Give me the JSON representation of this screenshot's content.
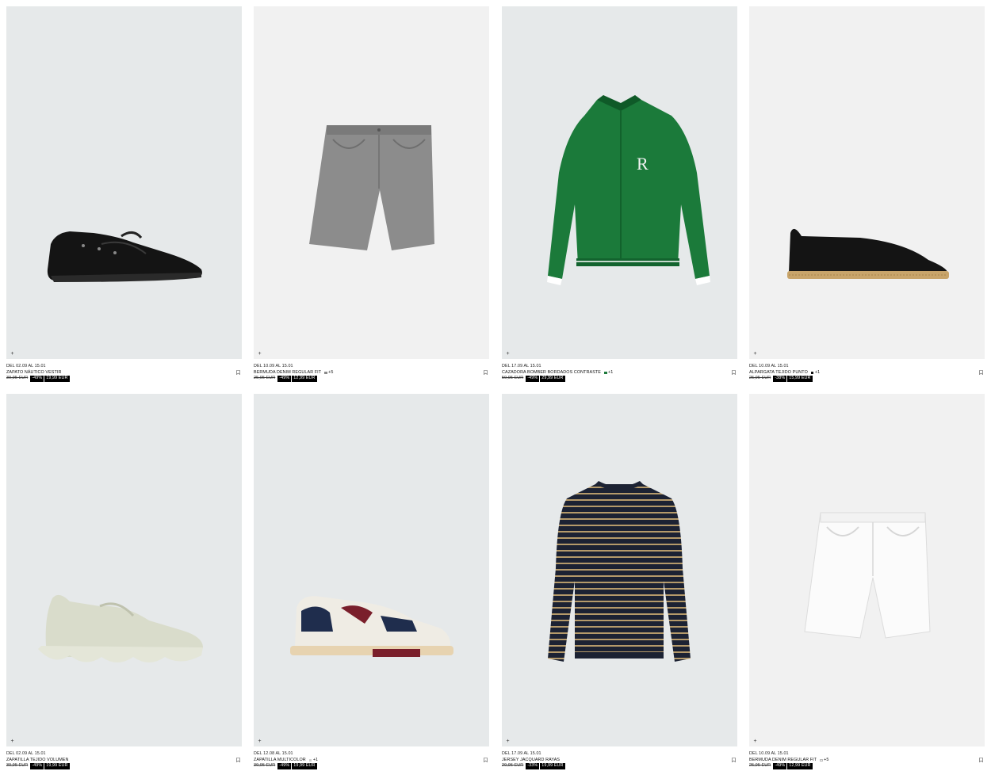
{
  "products": [
    {
      "date": "DEL 02.09 AL 15.01",
      "name": "ZAPATO NÁUTICO VESTIR",
      "swatch": "",
      "more": "",
      "old_price": "39,95 EUR",
      "discount": "-49%",
      "new_price": "19,99 EUR",
      "bg": "#e6e9ea",
      "icon": "boat-shoe"
    },
    {
      "date": "DEL 10.09 AL 15.01",
      "name": "BERMUDA DENIM REGULAR FIT",
      "swatch": "#8a8a8a",
      "more": "+5",
      "old_price": "25,95 EUR",
      "discount": "-49%",
      "new_price": "12,99 EUR",
      "bg": "#f1f1f1",
      "icon": "denim-shorts"
    },
    {
      "date": "DEL 17.09 AL 15.01",
      "name": "CAZADORA BOMBER BORDADOS CONTRASTE",
      "swatch": "#1f7a3d",
      "more": "+1",
      "old_price": "59,95 EUR",
      "discount": "-49%",
      "new_price": "29,99 EUR",
      "bg": "#e6e9ea",
      "icon": "bomber-jacket"
    },
    {
      "date": "DEL 10.09 AL 15.01",
      "name": "ALPARGATA TEJIDO PUNTO",
      "swatch": "#111111",
      "more": "+1",
      "old_price": "25,95 EUR",
      "discount": "-38%",
      "new_price": "15,99 EUR",
      "bg": "#f1f1f1",
      "icon": "espadrille"
    },
    {
      "date": "DEL 02.09 AL 15.01",
      "name": "ZAPATILLA TEJIDO VOLUMEN",
      "swatch": "",
      "more": "",
      "old_price": "39,95 EUR",
      "discount": "-49%",
      "new_price": "19,99 EUR",
      "bg": "#e6e9ea",
      "icon": "knit-sneaker"
    },
    {
      "date": "DEL 12.08 AL 15.01",
      "name": "ZAPATILLA MULTICOLOR",
      "swatch": "#cfcfcf",
      "more": "+1",
      "old_price": "39,95 EUR",
      "discount": "-49%",
      "new_price": "19,99 EUR",
      "bg": "#e6e9ea",
      "icon": "multicolor-sneaker"
    },
    {
      "date": "DEL 17.09 AL 15.01",
      "name": "JERSEY JACQUARD RAYAS",
      "swatch": "",
      "more": "",
      "old_price": "29,95 EUR",
      "discount": "-33%",
      "new_price": "19,99 EUR",
      "bg": "#e6e9ea",
      "icon": "striped-sweater"
    },
    {
      "date": "DEL 10.09 AL 15.01",
      "name": "BERMUDA DENIM REGULAR FIT",
      "swatch": "#eeeeee",
      "more": "+5",
      "old_price": "25,95 EUR",
      "discount": "-49%",
      "new_price": "12,99 EUR",
      "bg": "#f1f1f1",
      "icon": "white-shorts"
    }
  ],
  "ui": {
    "plus_glyph": "+"
  }
}
